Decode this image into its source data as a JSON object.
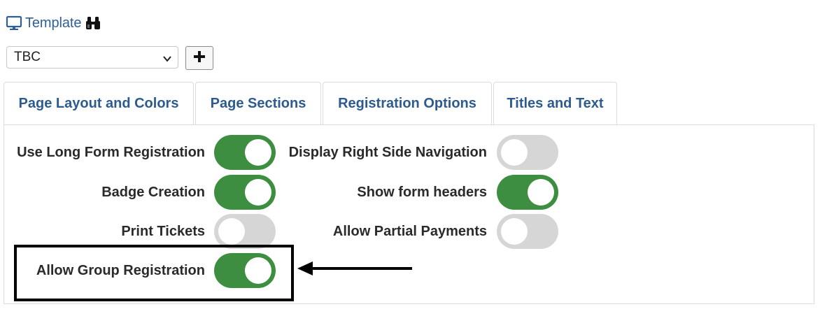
{
  "template": {
    "label": "Template",
    "icon": "monitor-icon",
    "search_icon": "binoculars-icon"
  },
  "template_select": {
    "selected": "TBC"
  },
  "add_button": {
    "icon": "plus-icon"
  },
  "tabs": [
    {
      "label": "Page Layout and Colors"
    },
    {
      "label": "Page Sections"
    },
    {
      "label": "Registration Options"
    },
    {
      "label": "Titles and Text"
    }
  ],
  "options": {
    "long_form": {
      "label": "Use Long Form Registration",
      "on": true
    },
    "right_nav": {
      "label": "Display Right Side Navigation",
      "on": false
    },
    "badge": {
      "label": "Badge Creation",
      "on": true
    },
    "form_headers": {
      "label": "Show form headers",
      "on": true
    },
    "print_tickets": {
      "label": "Print Tickets",
      "on": false
    },
    "partial_payments": {
      "label": "Allow Partial Payments",
      "on": false
    },
    "group_registration": {
      "label": "Allow Group Registration",
      "on": true
    }
  },
  "colors": {
    "link": "#2d5b8f",
    "toggle_on": "#3e8e41",
    "toggle_off": "#d6d6d6"
  }
}
